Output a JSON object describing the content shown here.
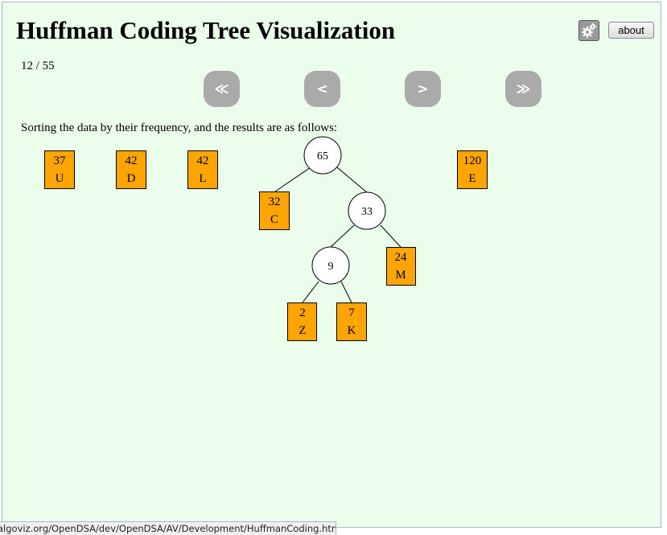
{
  "header": {
    "title": "Huffman Coding Tree Visualization",
    "settings_icon": "gears-icon",
    "about_label": "about"
  },
  "slideshow": {
    "current": 12,
    "total": 55,
    "counter_text": "12 / 55",
    "buttons": [
      {
        "name": "first-slide-button",
        "label": "≪",
        "icon": "double-chevron-left-icon"
      },
      {
        "name": "prev-slide-button",
        "label": "<",
        "icon": "chevron-left-icon"
      },
      {
        "name": "next-slide-button",
        "label": ">",
        "icon": "chevron-right-icon"
      },
      {
        "name": "last-slide-button",
        "label": "≫",
        "icon": "double-chevron-right-icon"
      }
    ],
    "message": "Sorting the data by their frequency, and the results are as follows:"
  },
  "colors": {
    "background": "#ebfdeb",
    "leaf_fill": "#ffa500",
    "internal_fill": "#ffffff",
    "nav_button": "#aaaaaa"
  },
  "forest": {
    "standalone_leaves": [
      {
        "weight": "37",
        "letter": "U"
      },
      {
        "weight": "42",
        "letter": "D"
      },
      {
        "weight": "42",
        "letter": "L"
      },
      {
        "weight": "120",
        "letter": "E"
      }
    ],
    "tree": {
      "root": {
        "weight": "65"
      },
      "leaf_c": {
        "weight": "32",
        "letter": "C"
      },
      "node_33": {
        "weight": "33"
      },
      "node_9": {
        "weight": "9"
      },
      "leaf_m": {
        "weight": "24",
        "letter": "M"
      },
      "leaf_z": {
        "weight": "2",
        "letter": "Z"
      },
      "leaf_k": {
        "weight": "7",
        "letter": "K"
      }
    }
  },
  "statusbar": {
    "url": "algoviz.org/OpenDSA/dev/OpenDSA/AV/Development/HuffmanCoding.html#"
  }
}
